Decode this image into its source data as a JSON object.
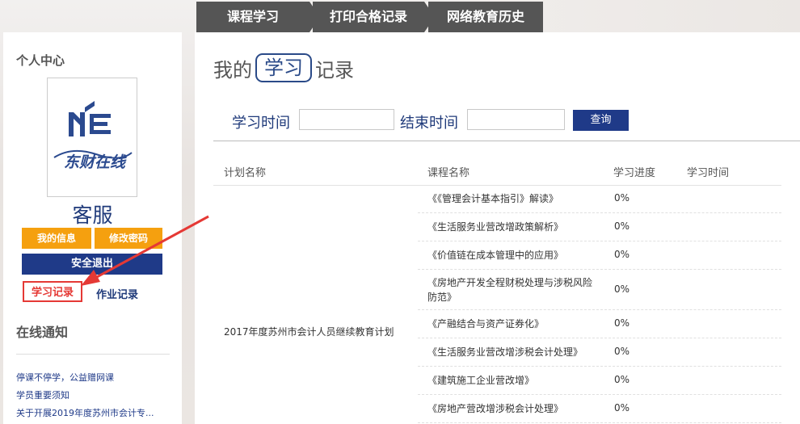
{
  "tabs": [
    "课程学习",
    "打印合格记录",
    "网络教育历史"
  ],
  "sidebar": {
    "title": "个人中心",
    "username": "客服",
    "buttons": {
      "info": "我的信息",
      "password": "修改密码",
      "logout": "安全退出"
    },
    "links": {
      "study": "学习记录",
      "homework": "作业记录"
    },
    "notice_title": "在线通知",
    "notices": [
      "停课不停学，公益赠网课",
      "学员重要须知",
      "关于开展2019年度苏州市会计专..."
    ],
    "logo_text": "东财在线"
  },
  "main": {
    "heading_pre": "我的",
    "heading_badge": "学习",
    "heading_post": "记录",
    "search": {
      "start_label": "学习时间",
      "end_label": "结束时间",
      "query_button": "查询"
    },
    "table": {
      "headers": [
        "计划名称",
        "课程名称",
        "学习进度",
        "学习时间"
      ],
      "plan": "2017年度苏州市会计人员继续教育计划",
      "rows": [
        {
          "course": "《《管理会计基本指引》解读》",
          "progress": "0%"
        },
        {
          "course": "《生活服务业营改增政策解析》",
          "progress": "0%"
        },
        {
          "course": "《价值链在成本管理中的应用》",
          "progress": "0%"
        },
        {
          "course": "《房地产开发全程财税处理与涉税风险防范》",
          "progress": "0%"
        },
        {
          "course": "《产融结合与资产证券化》",
          "progress": "0%"
        },
        {
          "course": "《生活服务业营改增涉税会计处理》",
          "progress": "0%"
        },
        {
          "course": "《建筑施工企业营改增》",
          "progress": "0%"
        },
        {
          "course": "《房地产营改增涉税会计处理》",
          "progress": "0%"
        }
      ]
    }
  },
  "colors": {
    "navy": "#1f3a88",
    "orange": "#f5a00f",
    "tab": "#555555",
    "highlight": "#e53935"
  }
}
